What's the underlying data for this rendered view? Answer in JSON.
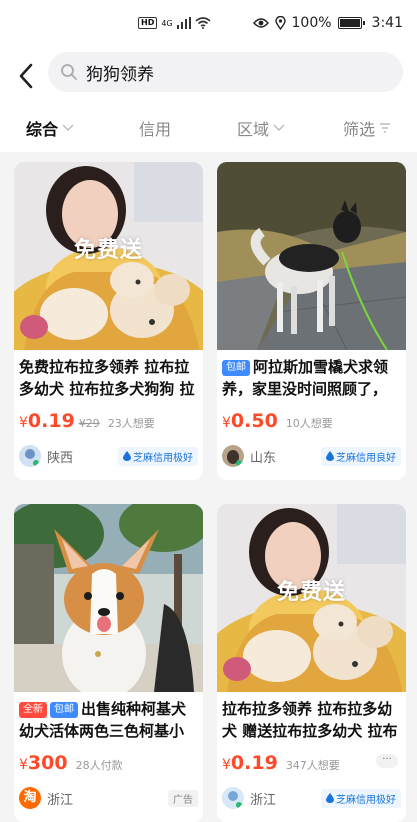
{
  "status_bar": {
    "network": "4G",
    "hd": "HD",
    "battery": "100%",
    "time": "3:41"
  },
  "search": {
    "query": "狗狗领养"
  },
  "filters": [
    {
      "label": "综合",
      "active": true
    },
    {
      "label": "信用",
      "active": false
    },
    {
      "label": "区域",
      "active": false
    },
    {
      "label": "筛选",
      "active": false
    }
  ],
  "items": [
    {
      "image_text": "免费送",
      "tags": [],
      "title": "免费拉布拉多领养 拉布拉多幼犬 拉布拉多犬狗狗 拉",
      "currency": "¥",
      "price": "0.19",
      "original_price": "¥29",
      "wants": "23人想要",
      "location": "陕西",
      "credit": "芝麻信用极好"
    },
    {
      "image_text": "",
      "tags": [
        "包邮"
      ],
      "title": "阿拉斯加雪橇犬求领养，家里没时间照顾了，",
      "currency": "¥",
      "price": "0.50",
      "original_price": "",
      "wants": "10人想要",
      "location": "山东",
      "credit": "芝麻信用良好"
    },
    {
      "image_text": "",
      "tags": [
        "全新",
        "包邮"
      ],
      "title": "出售纯种柯基犬幼犬活体两色三色柯基小",
      "currency": "¥",
      "price": "300",
      "original_price": "",
      "wants": "28人付款",
      "location": "浙江",
      "ad": "广告"
    },
    {
      "image_text": "免费送",
      "tags": [],
      "title": "拉布拉多领养 拉布拉多幼犬 赠送拉布拉多幼犬 拉布",
      "currency": "¥",
      "price": "0.19",
      "original_price": "",
      "wants": "347人想要",
      "location": "浙江",
      "credit": "芝麻信用极好",
      "more": "···"
    }
  ],
  "colors": {
    "price": "#ff4a2a",
    "credit": "#1a73d9",
    "tag_blue": "#3d8bff",
    "tag_red": "#ff4a3d"
  }
}
